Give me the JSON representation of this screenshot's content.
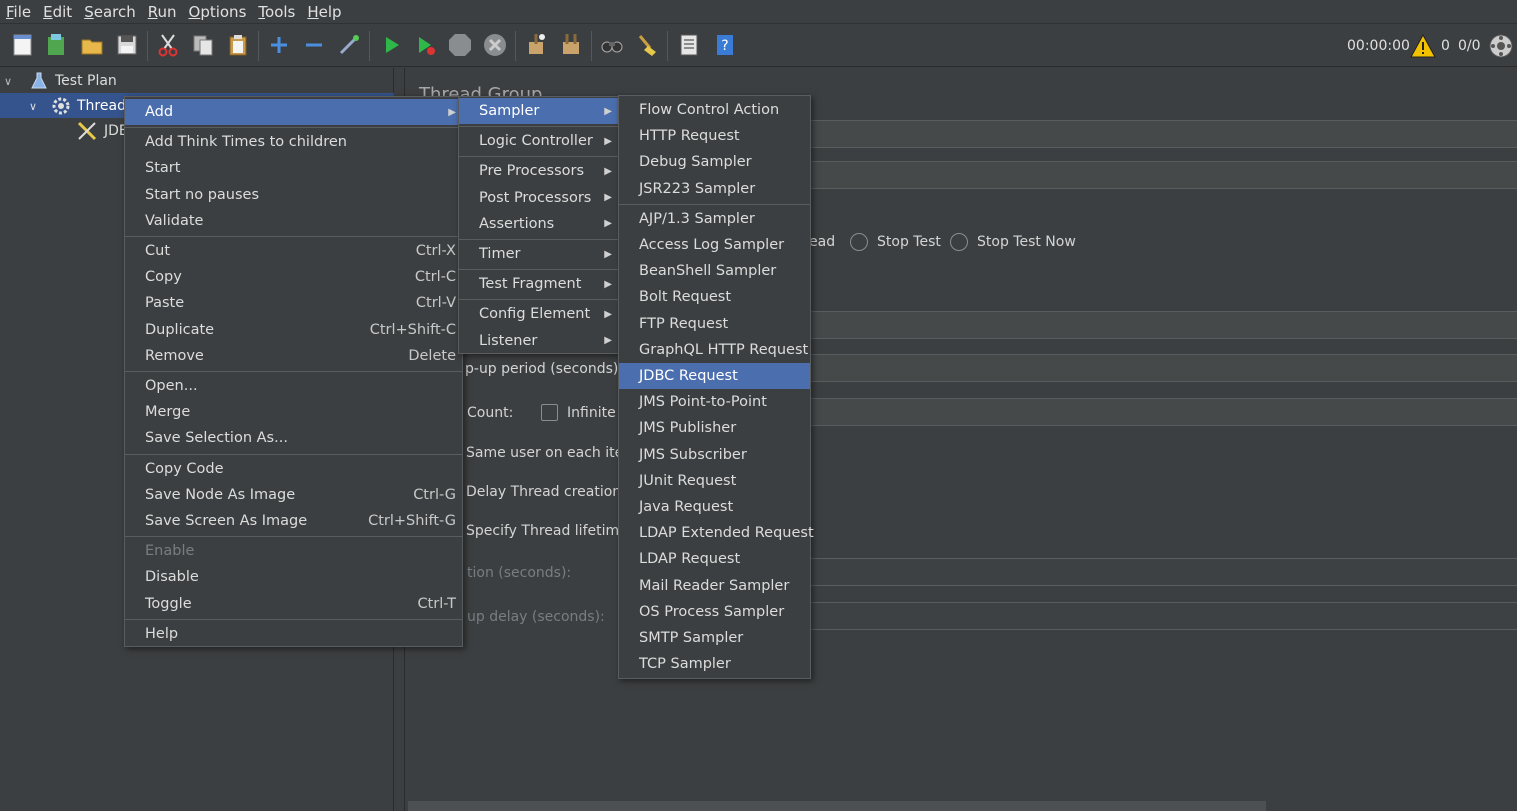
{
  "menubar": {
    "items": [
      {
        "mn": "F",
        "rest": "ile"
      },
      {
        "mn": "E",
        "rest": "dit"
      },
      {
        "mn": "S",
        "rest": "earch"
      },
      {
        "mn": "R",
        "rest": "un"
      },
      {
        "mn": "O",
        "rest": "ptions"
      },
      {
        "mn": "T",
        "rest": "ools"
      },
      {
        "mn": "H",
        "rest": "elp"
      }
    ]
  },
  "toolbar": {
    "timer": "00:00:00",
    "warning_count": "0",
    "threads": "0/0"
  },
  "tree": {
    "test_plan": "Test Plan",
    "thread_group": "Thread",
    "jdbc": "JDE"
  },
  "right_panel": {
    "title": "Thread Group",
    "action_fragment": "ead",
    "stop_test": "Stop Test",
    "stop_test_now": "Stop Test Now",
    "rampup_fragment": "p-up period (seconds):",
    "loop_fragment": "Count:",
    "infinite": "Infinite",
    "same_user_fragment": "Same user on each itera",
    "delay_fragment": "Delay Thread creation u",
    "specify_fragment": "Specify Thread lifetime",
    "duration_fragment": "tion (seconds):",
    "startup_fragment": "up delay (seconds):"
  },
  "context_menu": {
    "items": [
      {
        "label": "Add",
        "submenu": true,
        "selected": true
      },
      {
        "sep": true
      },
      {
        "label": "Add Think Times to children"
      },
      {
        "label": "Start"
      },
      {
        "label": "Start no pauses"
      },
      {
        "label": "Validate"
      },
      {
        "sep": true
      },
      {
        "label": "Cut",
        "acc": "Ctrl-X"
      },
      {
        "label": "Copy",
        "acc": "Ctrl-C"
      },
      {
        "label": "Paste",
        "acc": "Ctrl-V"
      },
      {
        "label": "Duplicate",
        "acc": "Ctrl+Shift-C"
      },
      {
        "label": "Remove",
        "acc": "Delete"
      },
      {
        "sep": true
      },
      {
        "label": "Open..."
      },
      {
        "label": "Merge"
      },
      {
        "label": "Save Selection As..."
      },
      {
        "sep": true
      },
      {
        "label": "Copy Code"
      },
      {
        "label": "Save Node As Image",
        "acc": "Ctrl-G"
      },
      {
        "label": "Save Screen As Image",
        "acc": "Ctrl+Shift-G"
      },
      {
        "sep": true
      },
      {
        "label": "Enable",
        "disabled": true
      },
      {
        "label": "Disable"
      },
      {
        "label": "Toggle",
        "acc": "Ctrl-T"
      },
      {
        "sep": true
      },
      {
        "label": "Help"
      }
    ]
  },
  "add_menu": {
    "items": [
      {
        "label": "Sampler",
        "submenu": true,
        "selected": true
      },
      {
        "sep": true
      },
      {
        "label": "Logic Controller",
        "submenu": true
      },
      {
        "sep": true
      },
      {
        "label": "Pre Processors",
        "submenu": true
      },
      {
        "label": "Post Processors",
        "submenu": true
      },
      {
        "label": "Assertions",
        "submenu": true
      },
      {
        "sep": true
      },
      {
        "label": "Timer",
        "submenu": true
      },
      {
        "sep": true
      },
      {
        "label": "Test Fragment",
        "submenu": true
      },
      {
        "sep": true
      },
      {
        "label": "Config Element",
        "submenu": true
      },
      {
        "label": "Listener",
        "submenu": true
      }
    ]
  },
  "sampler_menu": {
    "items": [
      {
        "label": "Flow Control Action"
      },
      {
        "label": "HTTP Request"
      },
      {
        "label": "Debug Sampler"
      },
      {
        "label": "JSR223 Sampler"
      },
      {
        "sep": true
      },
      {
        "label": "AJP/1.3 Sampler"
      },
      {
        "label": "Access Log Sampler"
      },
      {
        "label": "BeanShell Sampler"
      },
      {
        "label": "Bolt Request"
      },
      {
        "label": "FTP Request"
      },
      {
        "label": "GraphQL HTTP Request"
      },
      {
        "label": "JDBC Request",
        "selected": true
      },
      {
        "label": "JMS Point-to-Point"
      },
      {
        "label": "JMS Publisher"
      },
      {
        "label": "JMS Subscriber"
      },
      {
        "label": "JUnit Request"
      },
      {
        "label": "Java Request"
      },
      {
        "label": "LDAP Extended Request"
      },
      {
        "label": "LDAP Request"
      },
      {
        "label": "Mail Reader Sampler"
      },
      {
        "label": "OS Process Sampler"
      },
      {
        "label": "SMTP Sampler"
      },
      {
        "label": "TCP Sampler"
      }
    ]
  },
  "colors": {
    "background": "#3c3f41",
    "selection": "#4b6eaf",
    "text": "#dcdcdc"
  }
}
